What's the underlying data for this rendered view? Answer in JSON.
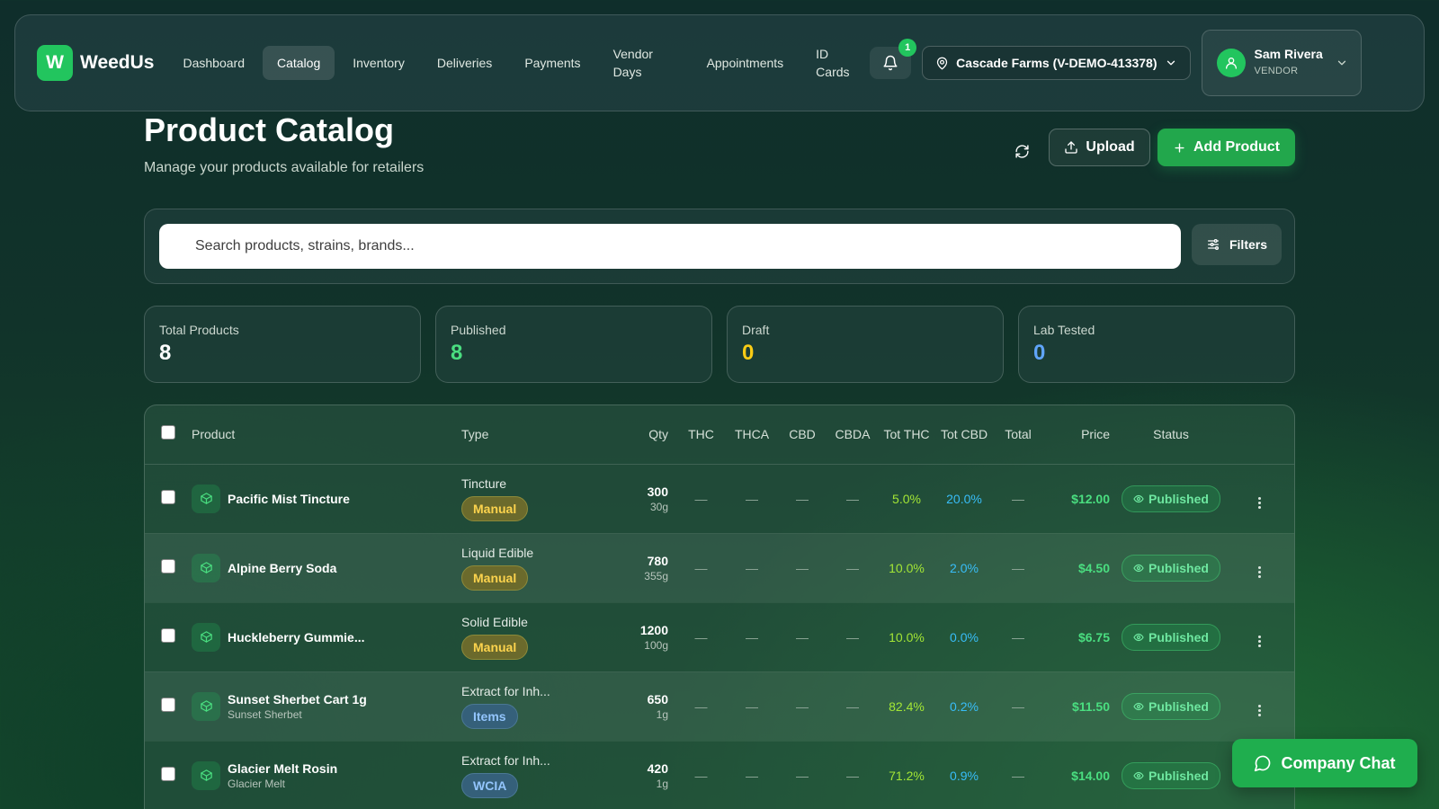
{
  "app": {
    "logo_letter": "W",
    "name": "WeedUs"
  },
  "nav": [
    {
      "label": "Dashboard",
      "key": "dashboard",
      "active": false
    },
    {
      "label": "Catalog",
      "key": "catalog",
      "active": true
    },
    {
      "label": "Inventory",
      "key": "inventory",
      "active": false
    },
    {
      "label": "Deliveries",
      "key": "deliveries",
      "active": false
    },
    {
      "label": "Payments",
      "key": "payments",
      "active": false
    },
    {
      "label": "Vendor Days",
      "key": "vendor-days",
      "active": false
    },
    {
      "label": "Appointments",
      "key": "appointments",
      "active": false
    },
    {
      "label": "ID Cards",
      "key": "id-cards",
      "active": false
    }
  ],
  "notifications": {
    "count": "1",
    "icon": "bell-icon"
  },
  "vendor_selector": {
    "label": "Cascade Farms (V-DEMO-413378)",
    "icon": "map-pin-icon"
  },
  "user": {
    "name": "Sam Rivera",
    "role": "VENDOR",
    "icon": "user-icon"
  },
  "header": {
    "title": "Product Catalog",
    "subtitle": "Manage your products available for retailers",
    "upload_label": "Upload",
    "add_label": "Add Product"
  },
  "search": {
    "placeholder": "Search products, strains, brands...",
    "filters_label": "Filters"
  },
  "stats": [
    {
      "label": "Total Products",
      "value": "8",
      "color": "#ffffff"
    },
    {
      "label": "Published",
      "value": "8",
      "color": "#4ade80"
    },
    {
      "label": "Draft",
      "value": "0",
      "color": "#facc15"
    },
    {
      "label": "Lab Tested",
      "value": "0",
      "color": "#60a5fa"
    }
  ],
  "table": {
    "columns": {
      "product": "Product",
      "type": "Type",
      "qty": "Qty",
      "thc": "THC",
      "thca": "THCA",
      "cbd": "CBD",
      "cbda": "CBDA",
      "tot_thc": "Tot THC",
      "tot_cbd": "Tot CBD",
      "total": "Total",
      "price": "Price",
      "status": "Status"
    },
    "rows": [
      {
        "name": "Pacific Mist Tincture",
        "strain": "",
        "type": "Tincture",
        "badge": "Manual",
        "badge_style": "manual",
        "qty": "300",
        "unit": "30g",
        "thc": "—",
        "thca": "—",
        "cbd": "—",
        "cbda": "—",
        "tot_thc": "5.0%",
        "tot_cbd": "20.0%",
        "total": "—",
        "price": "$12.00",
        "status": "Published"
      },
      {
        "name": "Alpine Berry Soda",
        "strain": "",
        "type": "Liquid Edible",
        "badge": "Manual",
        "badge_style": "manual",
        "qty": "780",
        "unit": "355g",
        "thc": "—",
        "thca": "—",
        "cbd": "—",
        "cbda": "—",
        "tot_thc": "10.0%",
        "tot_cbd": "2.0%",
        "total": "—",
        "price": "$4.50",
        "status": "Published"
      },
      {
        "name": "Huckleberry Gummie...",
        "strain": "",
        "type": "Solid Edible",
        "badge": "Manual",
        "badge_style": "manual",
        "qty": "1200",
        "unit": "100g",
        "thc": "—",
        "thca": "—",
        "cbd": "—",
        "cbda": "—",
        "tot_thc": "10.0%",
        "tot_cbd": "0.0%",
        "total": "—",
        "price": "$6.75",
        "status": "Published"
      },
      {
        "name": "Sunset Sherbet Cart 1g",
        "strain": "Sunset Sherbet",
        "type": "Extract for Inh...",
        "badge": "Items",
        "badge_style": "blue",
        "qty": "650",
        "unit": "1g",
        "thc": "—",
        "thca": "—",
        "cbd": "—",
        "cbda": "—",
        "tot_thc": "82.4%",
        "tot_cbd": "0.2%",
        "total": "—",
        "price": "$11.50",
        "status": "Published"
      },
      {
        "name": "Glacier Melt Rosin",
        "strain": "Glacier Melt",
        "type": "Extract for Inh...",
        "badge": "WCIA",
        "badge_style": "blue",
        "qty": "420",
        "unit": "1g",
        "thc": "—",
        "thca": "—",
        "cbd": "—",
        "cbda": "—",
        "tot_thc": "71.2%",
        "tot_cbd": "0.9%",
        "total": "—",
        "price": "$14.00",
        "status": "Published"
      }
    ]
  },
  "chat": {
    "label": "Company Chat",
    "icon": "chat-bubble-icon"
  }
}
